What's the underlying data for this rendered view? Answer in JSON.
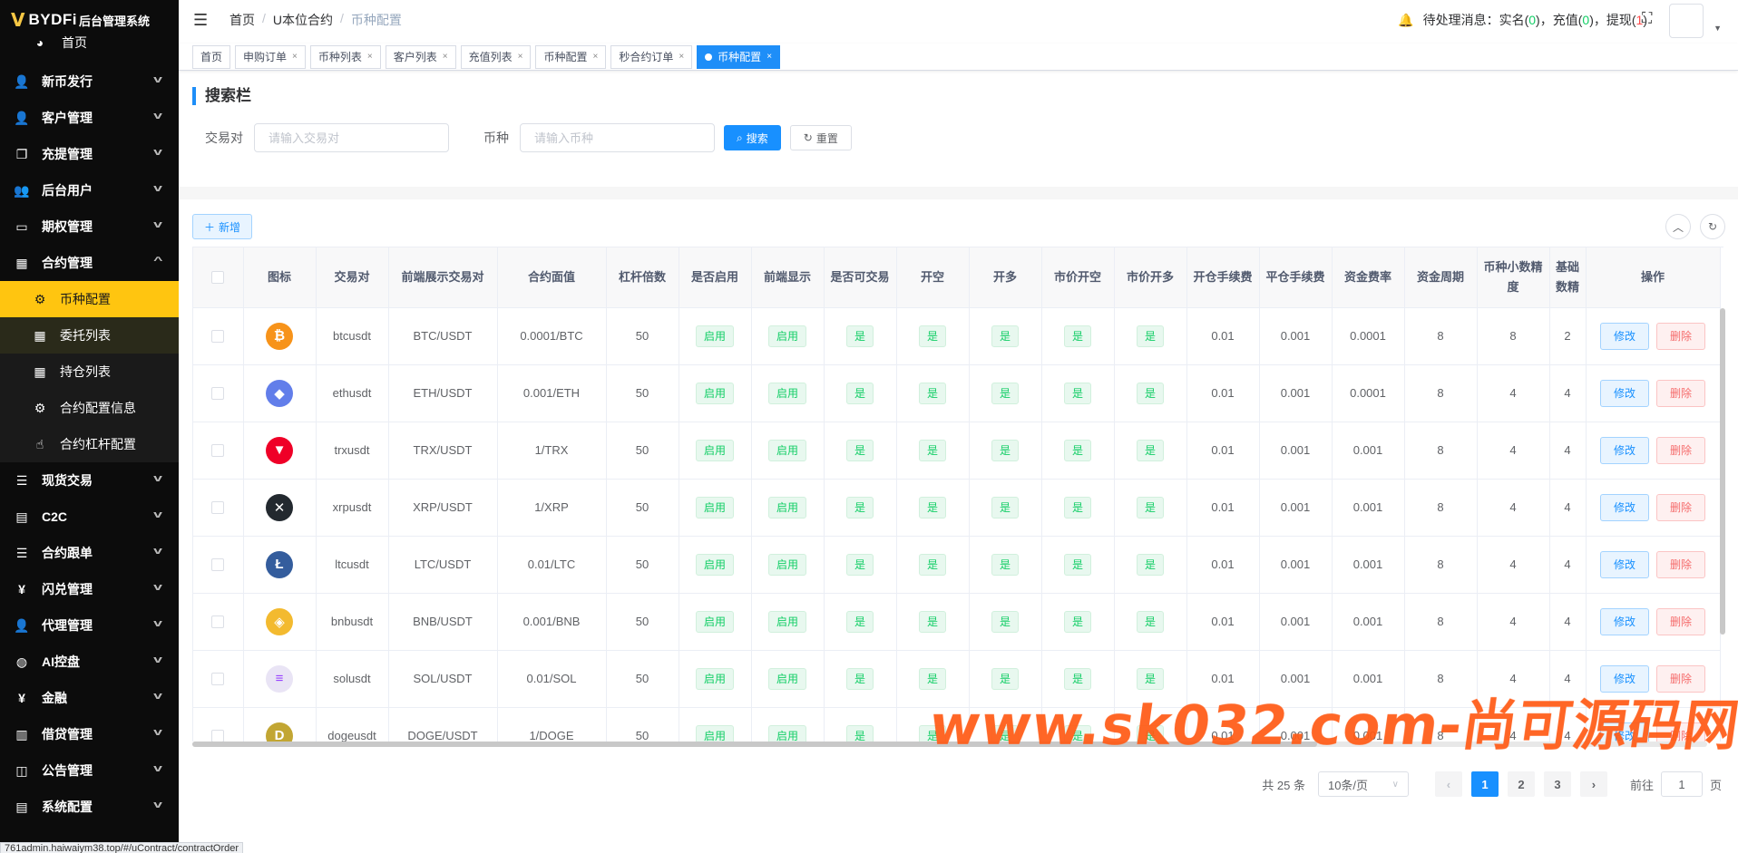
{
  "app": {
    "logo_mark": "V",
    "logo_text": "BYDFi",
    "logo_sub": "后台管理系统"
  },
  "sidebar": {
    "home": "首页",
    "items": [
      {
        "label": "新币发行",
        "icon": "user-icon"
      },
      {
        "label": "客户管理",
        "icon": "user-icon"
      },
      {
        "label": "充提管理",
        "icon": "copy-icon"
      },
      {
        "label": "后台用户",
        "icon": "users-icon"
      },
      {
        "label": "期权管理",
        "icon": "monitor-icon"
      },
      {
        "label": "合约管理",
        "icon": "table-icon",
        "expanded": true
      }
    ],
    "submenu": [
      {
        "label": "币种配置",
        "icon": "gear-icon",
        "active": true
      },
      {
        "label": "委托列表",
        "icon": "table-icon"
      },
      {
        "label": "持仓列表",
        "icon": "table-icon"
      },
      {
        "label": "合约配置信息",
        "icon": "gear-icon"
      },
      {
        "label": "合约杠杆配置",
        "icon": "hand-icon"
      }
    ],
    "items_after": [
      {
        "label": "现货交易",
        "icon": "list-icon"
      },
      {
        "label": "C2C",
        "icon": "doc-icon"
      },
      {
        "label": "合约跟单",
        "icon": "list-icon"
      },
      {
        "label": "闪兑管理",
        "icon": "yen-icon"
      },
      {
        "label": "代理管理",
        "icon": "user-icon"
      },
      {
        "label": "AI控盘",
        "icon": "robot-icon"
      },
      {
        "label": "金融",
        "icon": "yen-icon"
      },
      {
        "label": "借贷管理",
        "icon": "book-icon"
      },
      {
        "label": "公告管理",
        "icon": "book-open-icon"
      },
      {
        "label": "系统配置",
        "icon": "doc-icon"
      }
    ]
  },
  "header": {
    "breadcrumb": [
      "首页",
      "U本位合约",
      "币种配置"
    ],
    "notify_label": "待处理消息：",
    "notify_realname": "实名",
    "notify_realname_count": "0",
    "notify_recharge": "充值",
    "notify_recharge_count": "0",
    "notify_withdraw": "提现",
    "notify_withdraw_count": "1"
  },
  "tags": [
    {
      "label": "首页",
      "closable": false
    },
    {
      "label": "申购订单",
      "closable": true
    },
    {
      "label": "币种列表",
      "closable": true
    },
    {
      "label": "客户列表",
      "closable": true
    },
    {
      "label": "充值列表",
      "closable": true
    },
    {
      "label": "币种配置",
      "closable": true
    },
    {
      "label": "秒合约订单",
      "closable": true
    },
    {
      "label": "币种配置",
      "closable": true,
      "active": true
    }
  ],
  "search": {
    "title": "搜索栏",
    "pair_label": "交易对",
    "pair_placeholder": "请输入交易对",
    "coin_label": "币种",
    "coin_placeholder": "请输入币种",
    "search_button": "搜索",
    "reset_button": "重置"
  },
  "toolbar": {
    "add_button": "新增"
  },
  "table": {
    "columns": [
      "图标",
      "交易对",
      "前端展示交易对",
      "合约面值",
      "杠杆倍数",
      "是否启用",
      "前端显示",
      "是否可交易",
      "开空",
      "开多",
      "市价开空",
      "市价开多",
      "开仓手续费",
      "平仓手续费",
      "资金费率",
      "资金周期",
      "币种小数精度",
      "基础数精",
      "操作"
    ],
    "enabled_text": "启用",
    "yes_text": "是",
    "edit_text": "修改",
    "delete_text": "删除",
    "rows": [
      {
        "coin": "btc",
        "color": "#f7931a",
        "glyph": "₿",
        "pair": "btcusdt",
        "display": "BTC/USDT",
        "face": "0.0001/BTC",
        "leverage": "50",
        "open_fee": "0.01",
        "close_fee": "0.001",
        "rate": "0.0001",
        "period": "8",
        "precision": "8",
        "base": "2"
      },
      {
        "coin": "eth",
        "color": "#627eea",
        "glyph": "◆",
        "pair": "ethusdt",
        "display": "ETH/USDT",
        "face": "0.001/ETH",
        "leverage": "50",
        "open_fee": "0.01",
        "close_fee": "0.001",
        "rate": "0.0001",
        "period": "8",
        "precision": "4",
        "base": "4"
      },
      {
        "coin": "trx",
        "color": "#ef0027",
        "glyph": "▼",
        "pair": "trxusdt",
        "display": "TRX/USDT",
        "face": "1/TRX",
        "leverage": "50",
        "open_fee": "0.01",
        "close_fee": "0.001",
        "rate": "0.001",
        "period": "8",
        "precision": "4",
        "base": "4"
      },
      {
        "coin": "xrp",
        "color": "#23292f",
        "glyph": "✕",
        "pair": "xrpusdt",
        "display": "XRP/USDT",
        "face": "1/XRP",
        "leverage": "50",
        "open_fee": "0.01",
        "close_fee": "0.001",
        "rate": "0.001",
        "period": "8",
        "precision": "4",
        "base": "4"
      },
      {
        "coin": "ltc",
        "color": "#345d9d",
        "glyph": "Ł",
        "pair": "ltcusdt",
        "display": "LTC/USDT",
        "face": "0.01/LTC",
        "leverage": "50",
        "open_fee": "0.01",
        "close_fee": "0.001",
        "rate": "0.001",
        "period": "8",
        "precision": "4",
        "base": "4"
      },
      {
        "coin": "bnb",
        "color": "#f3ba2f",
        "glyph": "◈",
        "pair": "bnbusdt",
        "display": "BNB/USDT",
        "face": "0.001/BNB",
        "leverage": "50",
        "open_fee": "0.01",
        "close_fee": "0.001",
        "rate": "0.001",
        "period": "8",
        "precision": "4",
        "base": "4"
      },
      {
        "coin": "sol",
        "color": "#e9e4f5",
        "glyph": "≡",
        "pair": "solusdt",
        "display": "SOL/USDT",
        "face": "0.01/SOL",
        "leverage": "50",
        "open_fee": "0.01",
        "close_fee": "0.001",
        "rate": "0.001",
        "period": "8",
        "precision": "4",
        "base": "4"
      },
      {
        "coin": "doge",
        "color": "#c2a633",
        "glyph": "D",
        "pair": "dogeusdt",
        "display": "DOGE/USDT",
        "face": "1/DOGE",
        "leverage": "50",
        "open_fee": "0.01",
        "close_fee": "0.001",
        "rate": "0.001",
        "period": "8",
        "precision": "4",
        "base": "4"
      }
    ]
  },
  "pagination": {
    "total": "共 25 条",
    "page_size": "10条/页",
    "pages": [
      "1",
      "2",
      "3"
    ],
    "current": "1",
    "goto_label": "前往",
    "goto_value": "1",
    "goto_suffix": "页"
  },
  "watermark": "www.sk032.com-尚可源码网",
  "status_url": "761admin.haiwaiym38.top/#/uContract/contractOrder"
}
